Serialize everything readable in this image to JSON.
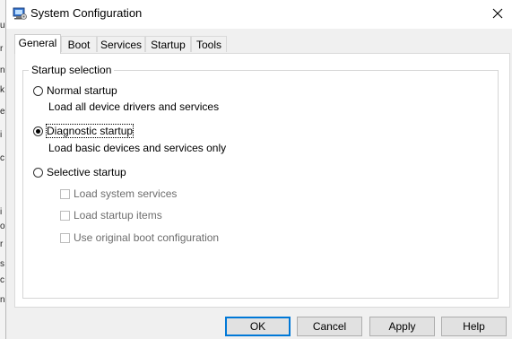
{
  "window": {
    "title": "System Configuration"
  },
  "tabs": [
    "General",
    "Boot",
    "Services",
    "Startup",
    "Tools"
  ],
  "startup_selection": {
    "legend": "Startup selection",
    "normal": {
      "label": "Normal startup",
      "description": "Load all device drivers and services",
      "selected": false
    },
    "diagnostic": {
      "label": "Diagnostic startup",
      "description": "Load basic devices and services only",
      "selected": true
    },
    "selective": {
      "label": "Selective startup",
      "selected": false,
      "options": [
        {
          "label": "Load system services",
          "checked": false,
          "enabled": false
        },
        {
          "label": "Load startup items",
          "checked": false,
          "enabled": false
        },
        {
          "label": "Use original boot configuration",
          "checked": false,
          "enabled": false
        }
      ]
    }
  },
  "buttons": {
    "ok": "OK",
    "cancel": "Cancel",
    "apply": "Apply",
    "help": "Help"
  },
  "colors": {
    "accent": "#0078d7",
    "window_bg": "#f0f0f0",
    "panel_bg": "#ffffff",
    "disabled_text": "#6d6d6d"
  },
  "icons": {
    "app": "system-configuration-icon",
    "close": "close-icon"
  }
}
